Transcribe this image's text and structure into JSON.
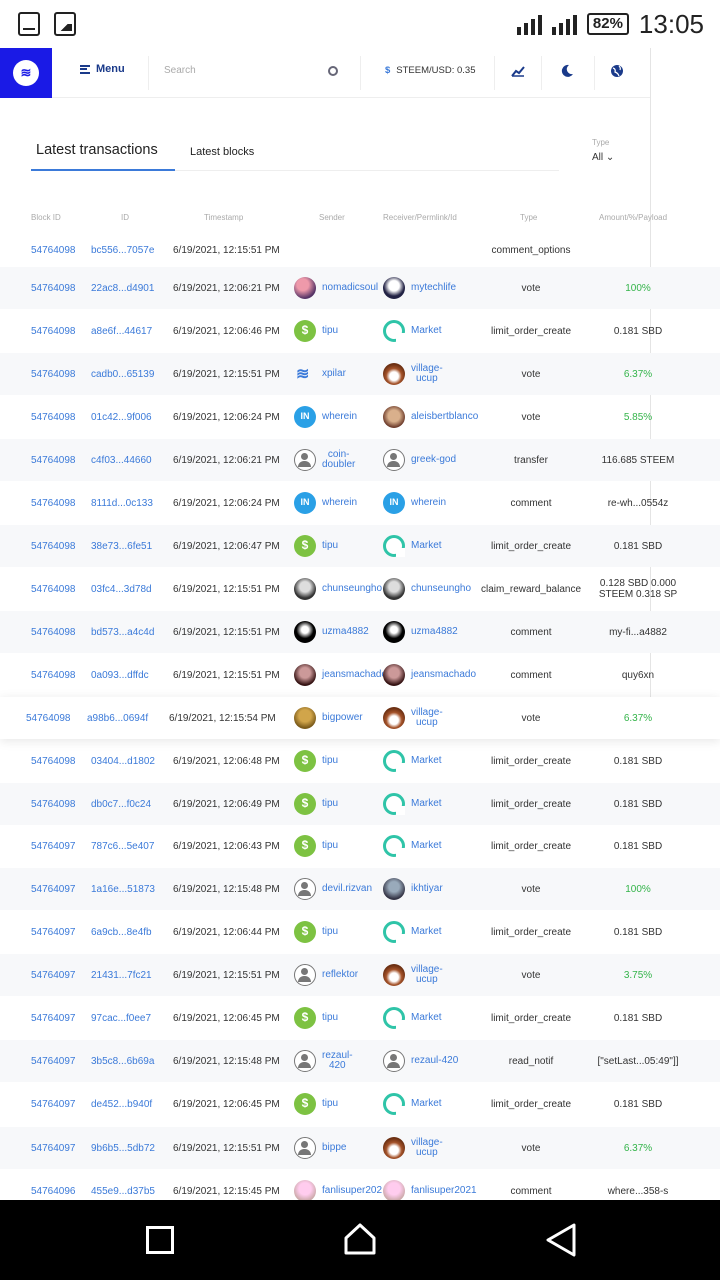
{
  "status": {
    "battery": "82%",
    "time": "13:05"
  },
  "nav": {
    "menu_label": "Menu",
    "search_placeholder": "Search",
    "price_label": "STEEM/USD: 0.35"
  },
  "tabs": {
    "active": "Latest transactions",
    "secondary": "Latest blocks"
  },
  "type_filter": {
    "label": "Type",
    "value": "All ⌄"
  },
  "columns": [
    "Block ID",
    "ID",
    "Timestamp",
    "Sender",
    "Receiver/Permlink/Id",
    "Type",
    "Amount/%/Payload"
  ],
  "rows": [
    {
      "block": "54764098",
      "id": "bc556...7057e",
      "ts": "6/19/2021, 12:15:51 PM",
      "sender": "",
      "sender_av": "",
      "receiver": "",
      "receiver_av": "",
      "type": "comment_options",
      "amount": "",
      "green": false
    },
    {
      "block": "54764098",
      "id": "22ac8...d4901",
      "ts": "6/19/2021, 12:06:21 PM",
      "sender": "nomadicsoul",
      "sender_av": "photo1",
      "receiver": "mytechlife",
      "receiver_av": "photo2",
      "type": "vote",
      "amount": "100%",
      "green": true
    },
    {
      "block": "54764098",
      "id": "a8e6f...44617",
      "ts": "6/19/2021, 12:06:46 PM",
      "sender": "tipu",
      "sender_av": "tipu",
      "receiver": "Market",
      "receiver_av": "market",
      "type": "limit_order_create",
      "amount": "0.181 SBD",
      "green": false
    },
    {
      "block": "54764098",
      "id": "cadb0...65139",
      "ts": "6/19/2021, 12:15:51 PM",
      "sender": "xpilar",
      "sender_av": "steem",
      "receiver": "village-\nucup",
      "receiver_av": "village",
      "type": "vote",
      "amount": "6.37%",
      "green": true
    },
    {
      "block": "54764098",
      "id": "01c42...9f006",
      "ts": "6/19/2021, 12:06:24 PM",
      "sender": "wherein",
      "sender_av": "wherein",
      "receiver": "aleisbertblanco",
      "receiver_av": "photo3",
      "type": "vote",
      "amount": "5.85%",
      "green": true
    },
    {
      "block": "54764098",
      "id": "c4f03...44660",
      "ts": "6/19/2021, 12:06:21 PM",
      "sender": "coin-\ndoubler",
      "sender_av": "generic",
      "receiver": "greek-god",
      "receiver_av": "generic",
      "type": "transfer",
      "amount": "116.685 STEEM",
      "green": false
    },
    {
      "block": "54764098",
      "id": "8111d...0c133",
      "ts": "6/19/2021, 12:06:24 PM",
      "sender": "wherein",
      "sender_av": "wherein",
      "receiver": "wherein",
      "receiver_av": "wherein",
      "type": "comment",
      "amount": "re-wh...0554z",
      "green": false
    },
    {
      "block": "54764098",
      "id": "38e73...6fe51",
      "ts": "6/19/2021, 12:06:47 PM",
      "sender": "tipu",
      "sender_av": "tipu",
      "receiver": "Market",
      "receiver_av": "market",
      "type": "limit_order_create",
      "amount": "0.181 SBD",
      "green": false
    },
    {
      "block": "54764098",
      "id": "03fc4...3d78d",
      "ts": "6/19/2021, 12:15:51 PM",
      "sender": "chunseungho",
      "sender_av": "photo4",
      "receiver": "chunseungho",
      "receiver_av": "photo4",
      "type": "claim_reward_balance",
      "amount": "0.128 SBD 0.000\nSTEEM 0.318 SP",
      "green": false
    },
    {
      "block": "54764098",
      "id": "bd573...a4c4d",
      "ts": "6/19/2021, 12:15:51 PM",
      "sender": "uzma4882",
      "sender_av": "photo6",
      "receiver": "uzma4882",
      "receiver_av": "photo6",
      "type": "comment",
      "amount": "my-fi...a4882",
      "green": false
    },
    {
      "block": "54764098",
      "id": "0a093...dffdc",
      "ts": "6/19/2021, 12:15:51 PM",
      "sender": "jeansmachado",
      "sender_av": "photo5",
      "receiver": "jeansmachado",
      "receiver_av": "photo5",
      "type": "comment",
      "amount": "quy6xn",
      "green": false
    },
    {
      "block": "54764098",
      "id": "a98b6...0694f",
      "ts": "6/19/2021, 12:15:54 PM",
      "sender": "bigpower",
      "sender_av": "photo7",
      "receiver": "village-\nucup",
      "receiver_av": "village",
      "type": "vote",
      "amount": "6.37%",
      "green": true
    },
    {
      "block": "54764098",
      "id": "03404...d1802",
      "ts": "6/19/2021, 12:06:48 PM",
      "sender": "tipu",
      "sender_av": "tipu",
      "receiver": "Market",
      "receiver_av": "market",
      "type": "limit_order_create",
      "amount": "0.181 SBD",
      "green": false
    },
    {
      "block": "54764098",
      "id": "db0c7...f0c24",
      "ts": "6/19/2021, 12:06:49 PM",
      "sender": "tipu",
      "sender_av": "tipu",
      "receiver": "Market",
      "receiver_av": "market",
      "type": "limit_order_create",
      "amount": "0.181 SBD",
      "green": false
    },
    {
      "block": "54764097",
      "id": "787c6...5e407",
      "ts": "6/19/2021, 12:06:43 PM",
      "sender": "tipu",
      "sender_av": "tipu",
      "receiver": "Market",
      "receiver_av": "market",
      "type": "limit_order_create",
      "amount": "0.181 SBD",
      "green": false
    },
    {
      "block": "54764097",
      "id": "1a16e...51873",
      "ts": "6/19/2021, 12:15:48 PM",
      "sender": "devil.rizvan",
      "sender_av": "generic",
      "receiver": "ikhtiyar",
      "receiver_av": "photo8",
      "type": "vote",
      "amount": "100%",
      "green": true
    },
    {
      "block": "54764097",
      "id": "6a9cb...8e4fb",
      "ts": "6/19/2021, 12:06:44 PM",
      "sender": "tipu",
      "sender_av": "tipu",
      "receiver": "Market",
      "receiver_av": "market",
      "type": "limit_order_create",
      "amount": "0.181 SBD",
      "green": false
    },
    {
      "block": "54764097",
      "id": "21431...7fc21",
      "ts": "6/19/2021, 12:15:51 PM",
      "sender": "reflektor",
      "sender_av": "generic",
      "receiver": "village-\nucup",
      "receiver_av": "village",
      "type": "vote",
      "amount": "3.75%",
      "green": true
    },
    {
      "block": "54764097",
      "id": "97cac...f0ee7",
      "ts": "6/19/2021, 12:06:45 PM",
      "sender": "tipu",
      "sender_av": "tipu",
      "receiver": "Market",
      "receiver_av": "market",
      "type": "limit_order_create",
      "amount": "0.181 SBD",
      "green": false
    },
    {
      "block": "54764097",
      "id": "3b5c8...6b69a",
      "ts": "6/19/2021, 12:15:48 PM",
      "sender": "rezaul-\n420",
      "sender_av": "generic",
      "receiver": "rezaul-420",
      "receiver_av": "generic",
      "type": "read_notif",
      "amount": "[\"setLast...05:49\"]]",
      "green": false
    },
    {
      "block": "54764097",
      "id": "de452...b940f",
      "ts": "6/19/2021, 12:06:45 PM",
      "sender": "tipu",
      "sender_av": "tipu",
      "receiver": "Market",
      "receiver_av": "market",
      "type": "limit_order_create",
      "amount": "0.181 SBD",
      "green": false
    },
    {
      "block": "54764097",
      "id": "9b6b5...5db72",
      "ts": "6/19/2021, 12:15:51 PM",
      "sender": "bippe",
      "sender_av": "generic",
      "receiver": "village-\nucup",
      "receiver_av": "village",
      "type": "vote",
      "amount": "6.37%",
      "green": true
    },
    {
      "block": "54764096",
      "id": "455e9...d37b5",
      "ts": "6/19/2021, 12:15:45 PM",
      "sender": "fanlisuper202",
      "sender_av": "photo9",
      "receiver": "fanlisuper2021",
      "receiver_av": "photo9",
      "type": "comment",
      "amount": "where...358-s",
      "green": false
    }
  ]
}
